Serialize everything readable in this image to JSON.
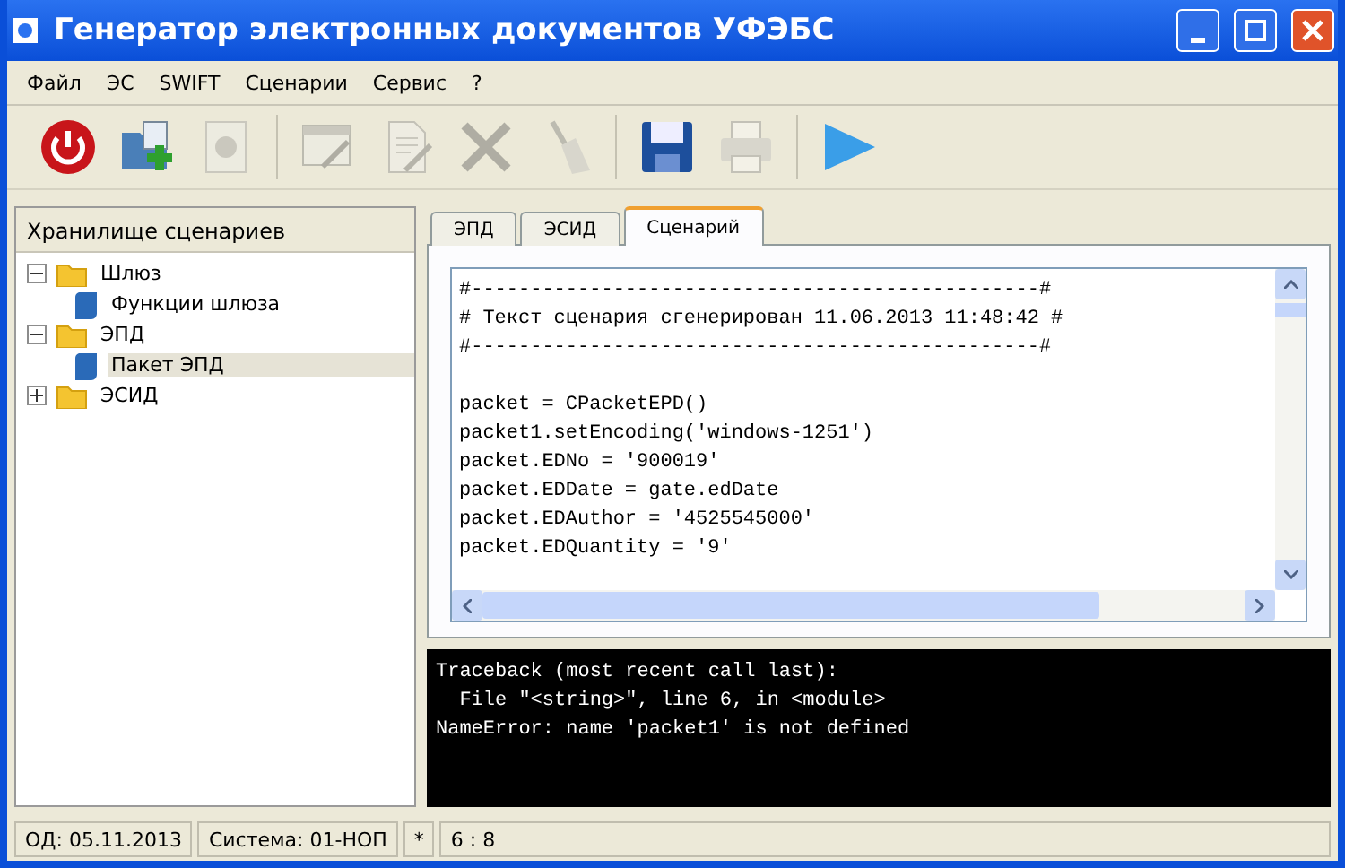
{
  "window": {
    "title": "Генератор электронных документов УФЭБС"
  },
  "menu": [
    "Файл",
    "ЭС",
    "SWIFT",
    "Сценарии",
    "Сервис",
    "?"
  ],
  "toolbar": [
    {
      "kind": "power",
      "disabled": false
    },
    {
      "kind": "folder-add",
      "disabled": false
    },
    {
      "kind": "disc",
      "disabled": true
    },
    {
      "kind": "separator"
    },
    {
      "kind": "form-edit",
      "disabled": true
    },
    {
      "kind": "doc-edit",
      "disabled": true
    },
    {
      "kind": "cross",
      "disabled": true
    },
    {
      "kind": "broom",
      "disabled": true
    },
    {
      "kind": "separator"
    },
    {
      "kind": "save",
      "disabled": false
    },
    {
      "kind": "print",
      "disabled": true
    },
    {
      "kind": "separator"
    },
    {
      "kind": "play",
      "disabled": false
    }
  ],
  "sidebar": {
    "title": "Хранилище сценариев",
    "items": [
      {
        "label": "Шлюз",
        "kind": "folder",
        "expanded": true,
        "selected": false,
        "children": [
          {
            "label": "Функции шлюза",
            "kind": "script",
            "selected": false
          }
        ]
      },
      {
        "label": "ЭПД",
        "kind": "folder",
        "expanded": true,
        "selected": false,
        "children": [
          {
            "label": "Пакет ЭПД",
            "kind": "script",
            "selected": true
          }
        ]
      },
      {
        "label": "ЭСИД",
        "kind": "folder",
        "expanded": false,
        "selected": false
      }
    ]
  },
  "tabs": [
    {
      "label": "ЭПД",
      "selected": false
    },
    {
      "label": "ЭСИД",
      "selected": false
    },
    {
      "label": "Сценарий",
      "selected": true
    }
  ],
  "editor": {
    "blocks": [
      [
        "#------------------------------------------------#",
        "# Текст сценария сгенерирован 11.06.2013 11:48:42 #",
        "#------------------------------------------------#"
      ],
      [
        "packet = CPacketEPD()",
        "packet1.setEncoding('windows-1251')",
        "packet.EDNo = '900019'",
        "packet.EDDate = gate.edDate",
        "packet.EDAuthor = '4525545000'",
        "packet.EDQuantity = '9'"
      ]
    ]
  },
  "console": {
    "lines": [
      "Traceback (most recent call last):",
      "  File \"<string>\", line 6, in <module>",
      "NameError: name 'packet1' is not defined"
    ]
  },
  "status_bar": [
    "ОД: 05.11.2013",
    "Система: 01-НОП",
    "*",
    "6 : 8"
  ]
}
